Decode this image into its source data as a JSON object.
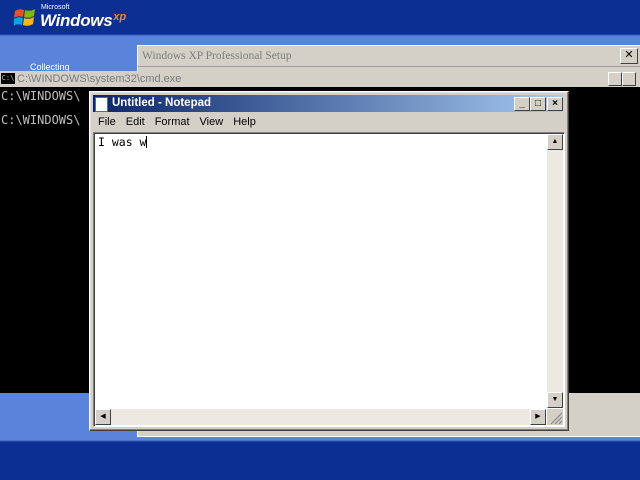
{
  "logo": {
    "microsoft": "Microsoft",
    "windows": "Windows",
    "xp": "xp"
  },
  "setup_window": {
    "title": "Windows XP Professional Setup",
    "close": "✕",
    "stub": "Collecting"
  },
  "cmd": {
    "icon": "C:\\",
    "title": "C:\\WINDOWS\\system32\\cmd.exe",
    "lines": [
      "C:\\WINDOWS\\",
      "C:\\WINDOWS\\"
    ]
  },
  "notepad": {
    "title": "Untitled - Notepad",
    "menus": [
      "File",
      "Edit",
      "Format",
      "View",
      "Help"
    ],
    "content": "I was w",
    "buttons": {
      "minimize": "_",
      "maximize": "□",
      "close": "×"
    }
  },
  "colors": {
    "titlebar_start": "#0a246a",
    "titlebar_end": "#a6caf0",
    "setup_bg": "#5a84dc",
    "cmd_bg": "#000000"
  }
}
